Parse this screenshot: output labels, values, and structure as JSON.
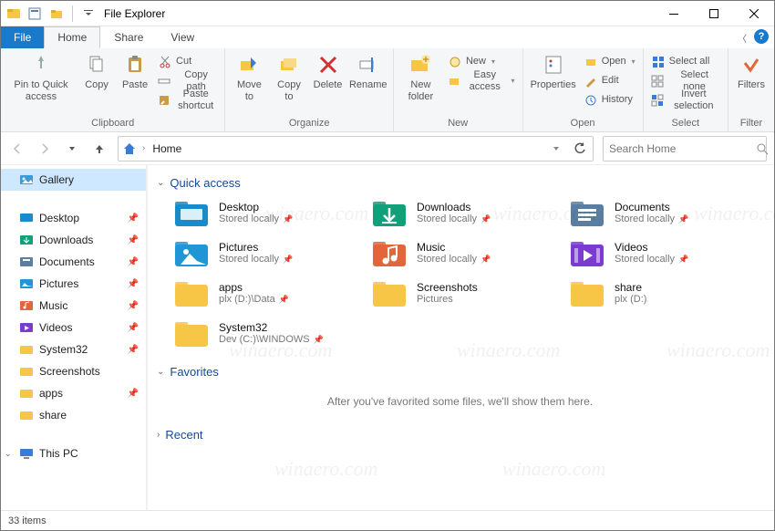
{
  "window": {
    "title": "File Explorer"
  },
  "tabs": {
    "file": "File",
    "home": "Home",
    "share": "Share",
    "view": "View"
  },
  "ribbon": {
    "clipboard": {
      "label": "Clipboard",
      "pin": "Pin to Quick access",
      "copy": "Copy",
      "paste": "Paste",
      "cut": "Cut",
      "copy_path": "Copy path",
      "paste_shortcut": "Paste shortcut"
    },
    "organize": {
      "label": "Organize",
      "move_to": "Move to",
      "copy_to": "Copy to",
      "delete": "Delete",
      "rename": "Rename"
    },
    "new": {
      "label": "New",
      "new_folder": "New folder",
      "new_item": "New",
      "easy_access": "Easy access"
    },
    "open": {
      "label": "Open",
      "properties": "Properties",
      "open": "Open",
      "edit": "Edit",
      "history": "History"
    },
    "select": {
      "label": "Select",
      "select_all": "Select all",
      "select_none": "Select none",
      "invert": "Invert selection"
    },
    "filter": {
      "label": "Filter",
      "filters": "Filters"
    }
  },
  "nav": {
    "home": "Home"
  },
  "search": {
    "placeholder": "Search Home"
  },
  "navpane": {
    "gallery": "Gallery",
    "desktop": "Desktop",
    "downloads": "Downloads",
    "documents": "Documents",
    "pictures": "Pictures",
    "music": "Music",
    "videos": "Videos",
    "system32": "System32",
    "screenshots": "Screenshots",
    "apps": "apps",
    "share": "share",
    "this_pc": "This PC"
  },
  "sections": {
    "quick_access": "Quick access",
    "favorites": "Favorites",
    "recent": "Recent",
    "fav_empty": "After you've favorited some files, we'll show them here."
  },
  "quick_access": [
    {
      "name": "Desktop",
      "sub": "Stored locally",
      "pin": true,
      "icon": "desktop",
      "color": "#1a8bc9"
    },
    {
      "name": "Downloads",
      "sub": "Stored locally",
      "pin": true,
      "icon": "downloads",
      "color": "#11a07a"
    },
    {
      "name": "Documents",
      "sub": "Stored locally",
      "pin": true,
      "icon": "documents",
      "color": "#5a7ea1"
    },
    {
      "name": "Pictures",
      "sub": "Stored locally",
      "pin": true,
      "icon": "pictures",
      "color": "#2196d6"
    },
    {
      "name": "Music",
      "sub": "Stored locally",
      "pin": true,
      "icon": "music",
      "color": "#e1663c"
    },
    {
      "name": "Videos",
      "sub": "Stored locally",
      "pin": true,
      "icon": "videos",
      "color": "#7b3bd1"
    },
    {
      "name": "apps",
      "sub": "plx (D:)\\Data",
      "pin": true,
      "icon": "folder",
      "color": "#f7c646"
    },
    {
      "name": "Screenshots",
      "sub": "Pictures",
      "pin": false,
      "icon": "folder",
      "color": "#f7c646"
    },
    {
      "name": "share",
      "sub": "plx (D:)",
      "pin": false,
      "icon": "folder",
      "color": "#f7c646"
    },
    {
      "name": "System32",
      "sub": "Dev (C:)\\WINDOWS",
      "pin": true,
      "icon": "folder",
      "color": "#f7c646"
    }
  ],
  "status": {
    "items": "33 items"
  },
  "watermark": "winaero.com"
}
